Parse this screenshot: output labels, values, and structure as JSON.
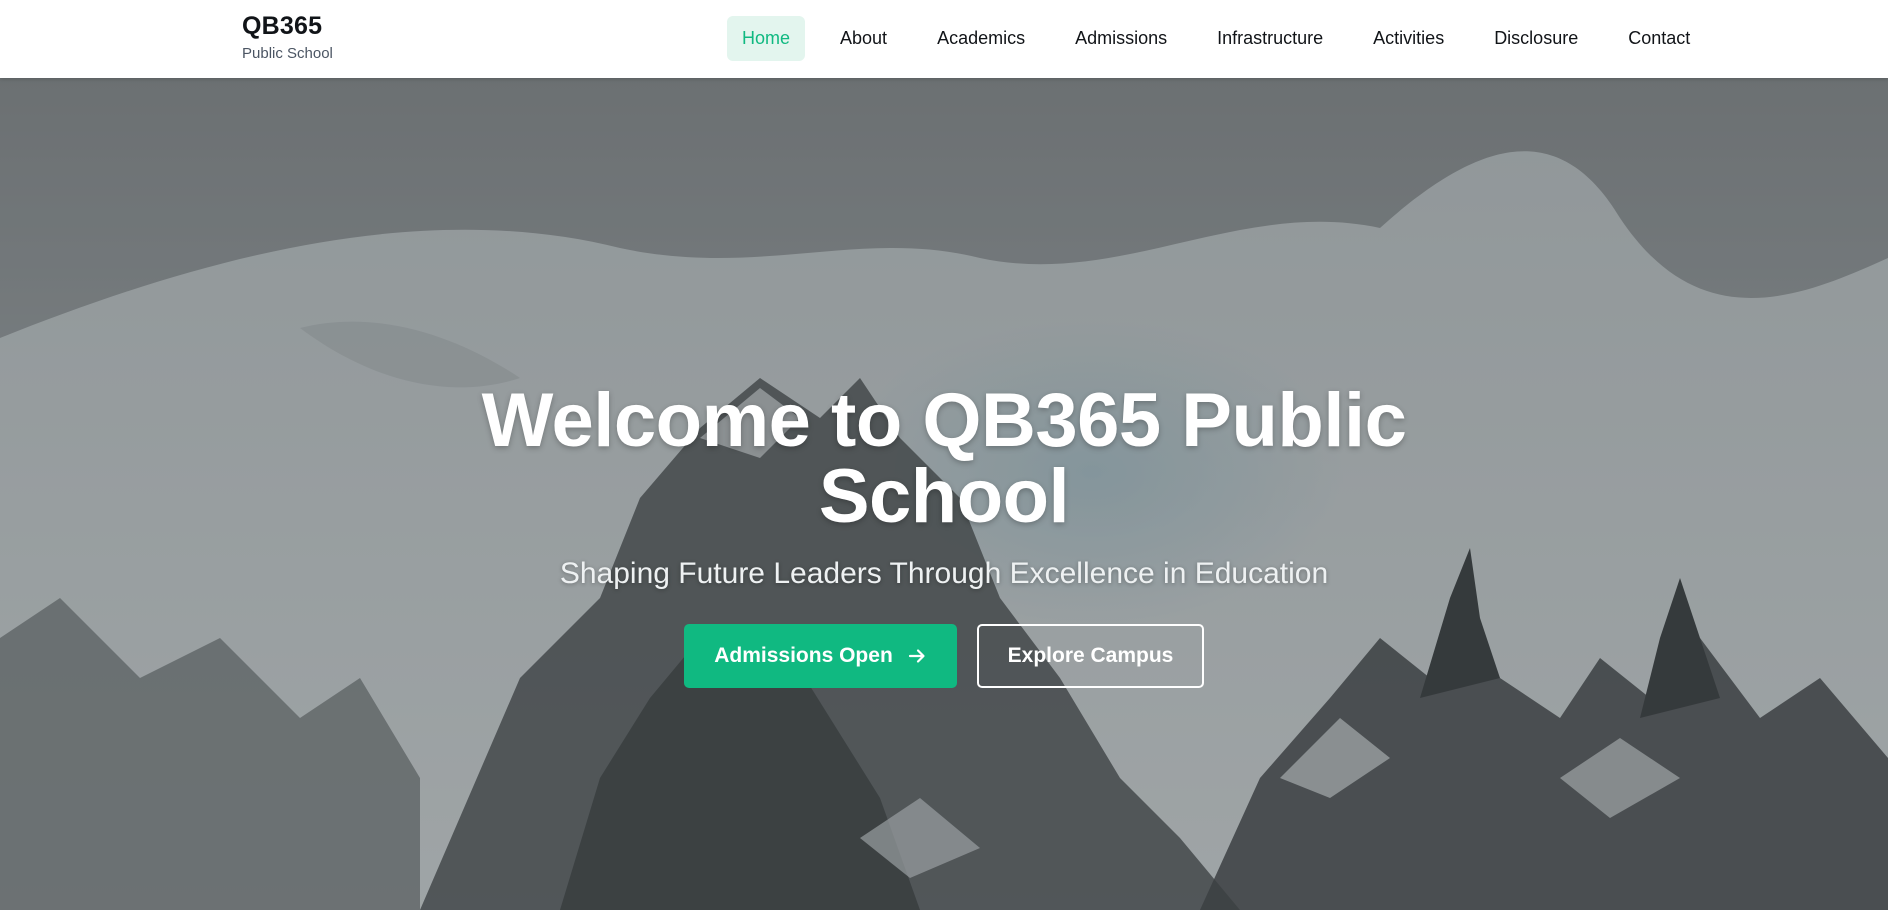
{
  "header": {
    "brand_name": "QB365",
    "brand_subtitle": "Public School",
    "nav": [
      {
        "label": "Home",
        "active": true
      },
      {
        "label": "About"
      },
      {
        "label": "Academics"
      },
      {
        "label": "Admissions"
      },
      {
        "label": "Infrastructure"
      },
      {
        "label": "Activities"
      },
      {
        "label": "Disclosure"
      },
      {
        "label": "Contact"
      }
    ]
  },
  "hero": {
    "title": "Welcome to QB365 Public School",
    "subtitle": "Shaping Future Leaders Through Excellence in Education",
    "primary_button": {
      "label": "Admissions Open",
      "icon": "arrow-right-icon"
    },
    "secondary_button": {
      "label": "Explore Campus"
    },
    "background": "snowy mountain landscape"
  },
  "colors": {
    "accent": "#10b981",
    "accent_light": "#e3f5ee",
    "text_dark": "#111418",
    "header_bg": "#ffffff"
  }
}
